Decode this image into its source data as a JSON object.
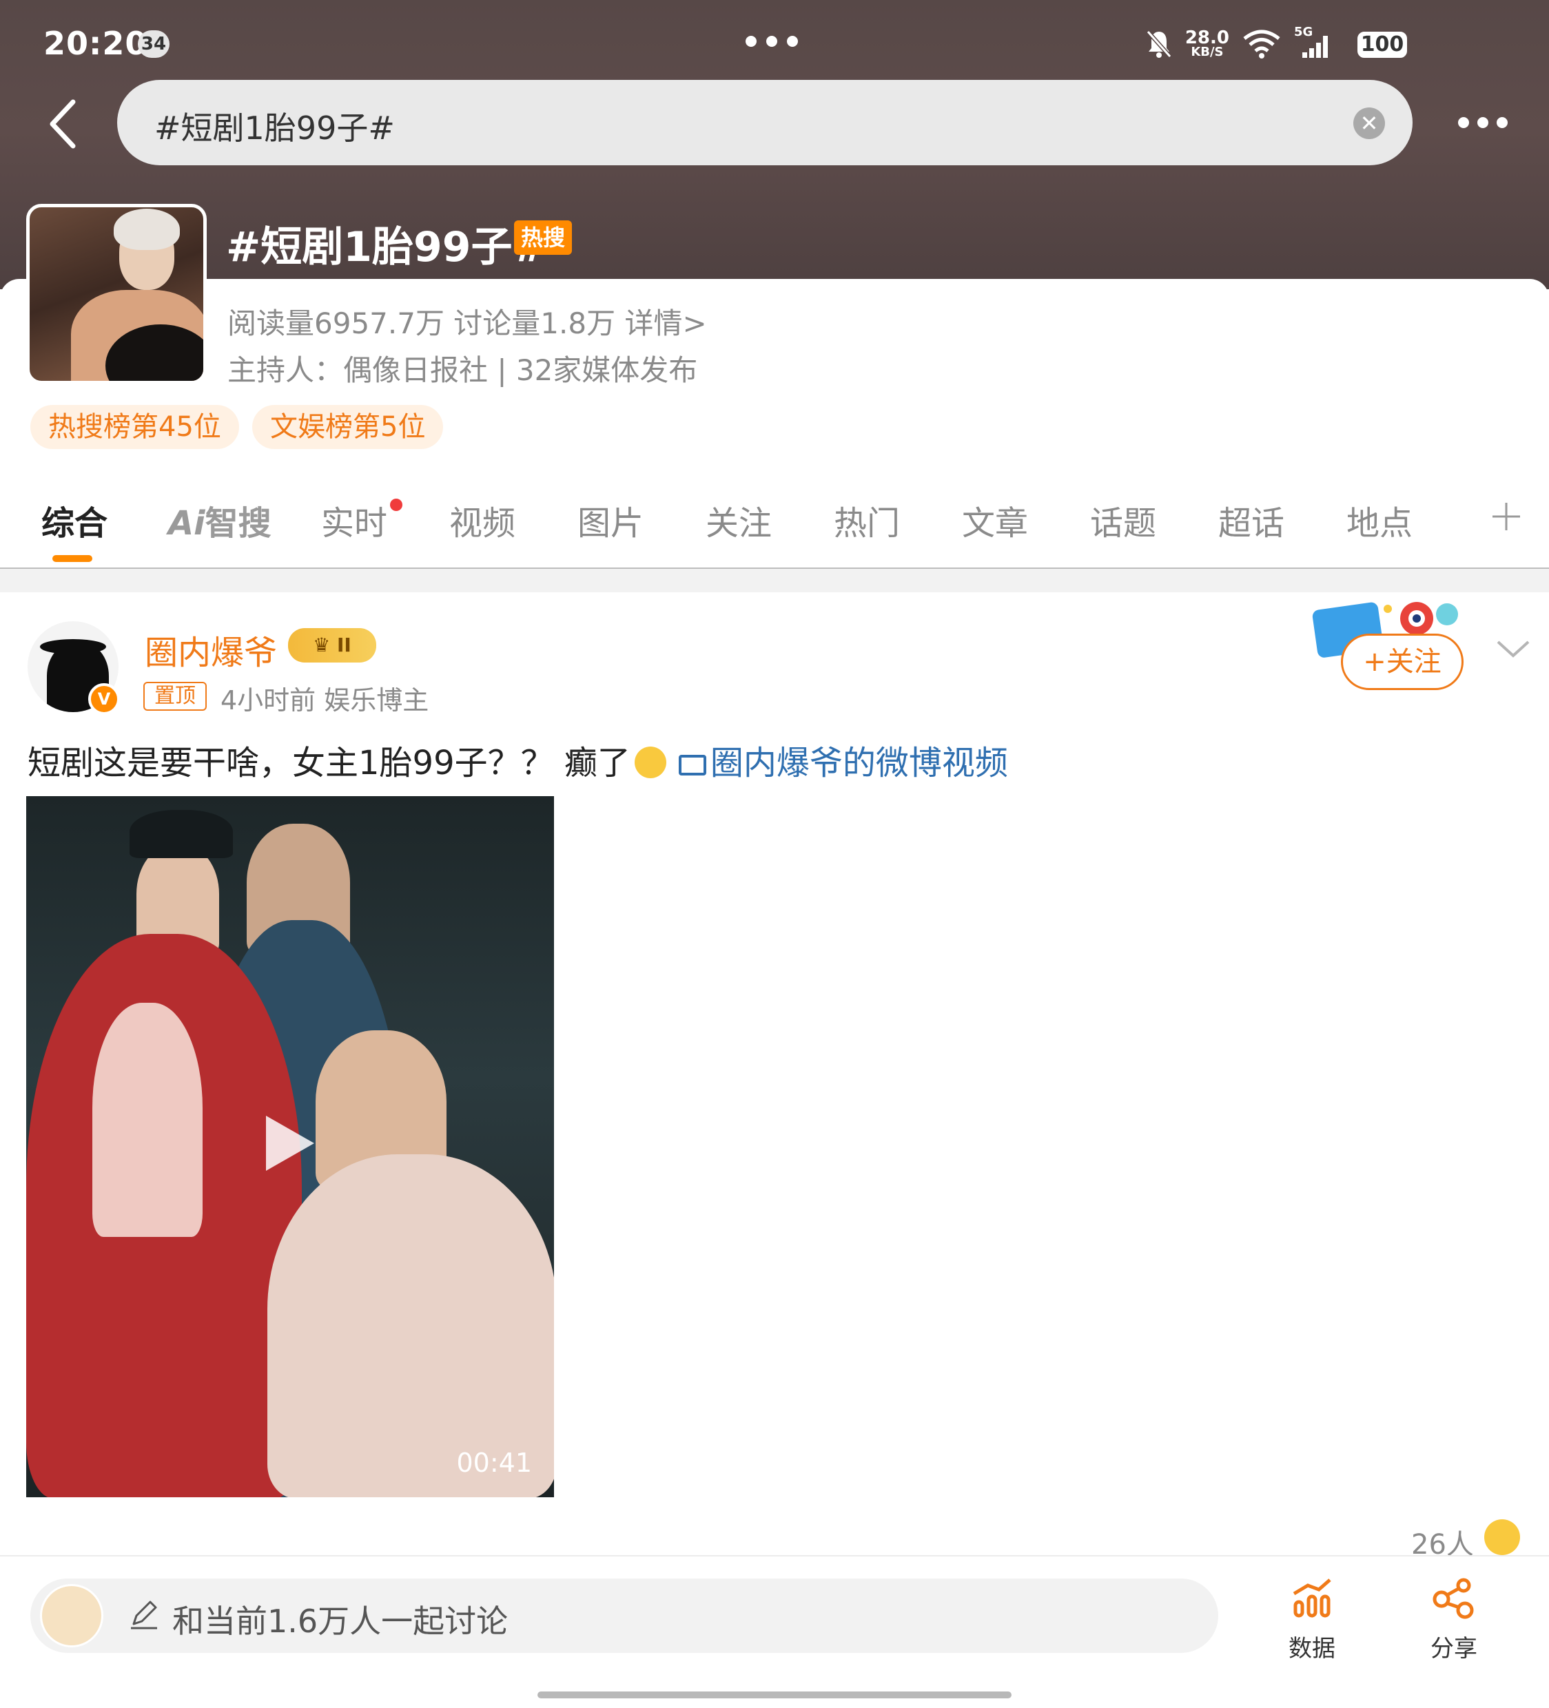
{
  "status_bar": {
    "time": "20:20",
    "notification_count": "34",
    "net_speed": "28.0",
    "net_unit": "KB/S",
    "network": "5G",
    "battery": "100"
  },
  "search": {
    "query": "#短剧1胎99子#"
  },
  "topic": {
    "title": "#短剧1胎99子#",
    "hot_tag": "热搜",
    "stats": "阅读量6957.7万  讨论量1.8万  详情>",
    "host": "主持人：偶像日报社 | 32家媒体发布",
    "ranks": [
      "热搜榜第45位",
      "文娱榜第5位"
    ]
  },
  "tabs": {
    "items": [
      "综合",
      "智搜",
      "实时",
      "视频",
      "图片",
      "关注",
      "热门",
      "文章",
      "话题",
      "超话",
      "地点"
    ],
    "ai_prefix": "Ai",
    "active": "综合"
  },
  "post": {
    "author": "圈内爆爷",
    "vip_level": "II",
    "pin_label": "置顶",
    "meta": "4小时前  娱乐博主",
    "follow_label": "+关注",
    "text": "短剧这是要干啥，女主1胎99子？？ 癫了",
    "link_text": "圈内爆爷的微博视频",
    "video_duration": "00:41",
    "reaction_count": "26人"
  },
  "bottom_bar": {
    "compose_placeholder": "和当前1.6万人一起讨论",
    "data_label": "数据",
    "share_label": "分享"
  },
  "colors": {
    "accent": "#f07a18",
    "hot_orange": "#ff8a00",
    "link_blue": "#2f6fb0",
    "header_bg": "#574847"
  }
}
